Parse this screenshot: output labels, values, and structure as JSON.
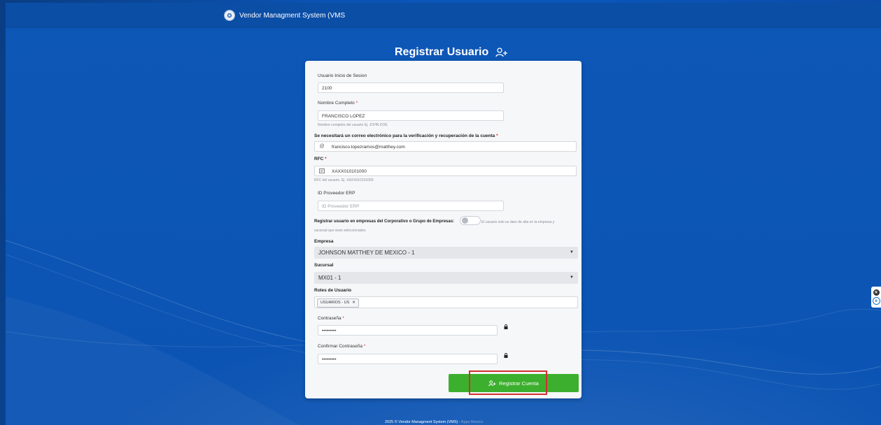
{
  "header": {
    "app_title": "Vendor Managment System (VMS"
  },
  "page": {
    "title": "Registrar Usuario"
  },
  "form": {
    "login_label": "Usuario Inicio de Sesion",
    "login_value": "2100",
    "fullname_label": "Nombre Completo",
    "fullname_value": "FRANCISCO LOPEZ",
    "fullname_hint": "Nombre completo del usuario Ej. JOHN DOE",
    "email_label": "Se necesitará un correo electrónico para la verificación y recuperación de la cuenta",
    "email_value": "francisco.lopezramos@matthey.com",
    "rfc_label": "RFC",
    "rfc_value": "XAXX010101000",
    "rfc_hint": "RFC del usuario. Ej. XAXX010101000",
    "erp_label": "ID Proveedor ERP",
    "erp_placeholder": "ID Proveedor ERP",
    "corporate_label": "Registrar usuario en empresas del Corporativo o Grupo de Empresas:",
    "corporate_hint_1": "El usuario solo se dare de alta en la empresa y",
    "corporate_hint_2": "sucursal que sean seleccionados",
    "empresa_label": "Empresa",
    "empresa_value": "JOHNSON MATTHEY DE MEXICO - 1",
    "sucursal_label": "Sucursal",
    "sucursal_value": "MX01 - 1",
    "roles_label": "Roles de Usuario",
    "roles": [
      "USUARIOS - US"
    ],
    "password_label": "Contraseña",
    "password_value": "•••••••••",
    "confirm_label": "Confirmar Contraseña",
    "confirm_value": "•••••••••",
    "required_mark": "*",
    "submit_label": "Registrar Cuenta"
  },
  "footer": {
    "text": "2025 © Vendor Managment System (VMS) -",
    "link": "Apps Mexico"
  },
  "colors": {
    "background": "#0c54b3",
    "topbar": "#0b4ea6",
    "primary_button": "#3cb02e",
    "highlight": "#d32f2f",
    "required": "#e02b2b"
  }
}
